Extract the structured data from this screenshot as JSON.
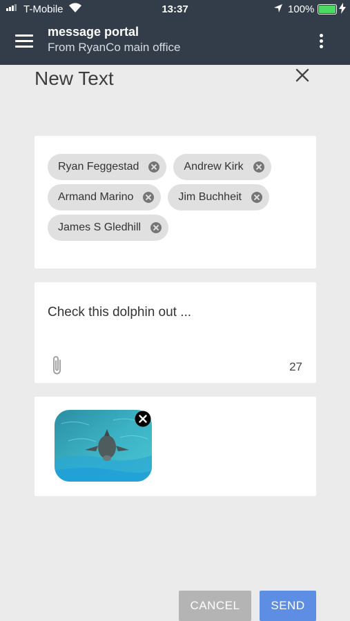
{
  "status_bar": {
    "carrier": "T-Mobile",
    "time": "13:37",
    "battery": "100%"
  },
  "header": {
    "title": "message portal",
    "subtitle": "From RyanCo main office"
  },
  "page": {
    "title": "New Text"
  },
  "recipients": [
    {
      "name": "Ryan Feggestad"
    },
    {
      "name": "Andrew Kirk"
    },
    {
      "name": "Armand Marino"
    },
    {
      "name": "Jim Buchheit"
    },
    {
      "name": "James S Gledhill"
    }
  ],
  "message": {
    "text": "Check this dolphin out ...",
    "char_count": "27"
  },
  "actions": {
    "cancel_label": "CANCEL",
    "send_label": "SEND"
  },
  "colors": {
    "header_bg": "#333d49",
    "send_button": "#5d8ee3",
    "cancel_button": "#b4b4b4",
    "battery": "#4cd964"
  }
}
